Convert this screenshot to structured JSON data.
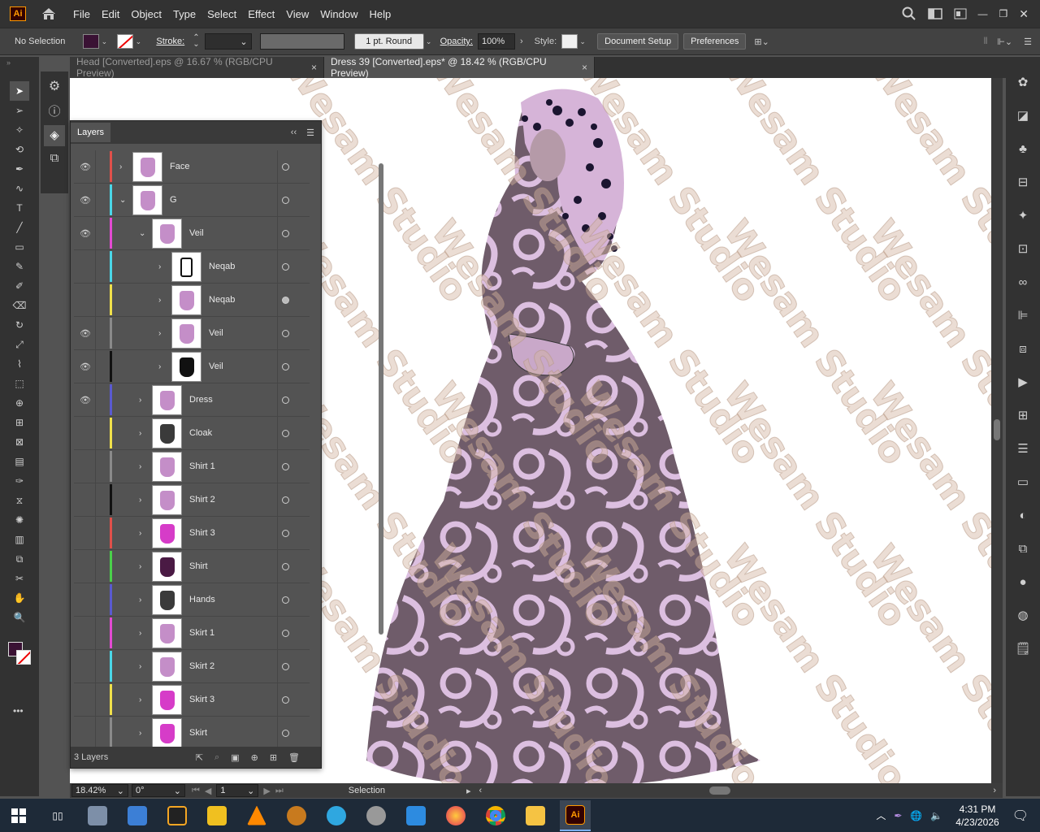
{
  "app": {
    "logo": "Ai"
  },
  "menu": [
    "File",
    "Edit",
    "Object",
    "Type",
    "Select",
    "Effect",
    "View",
    "Window",
    "Help"
  ],
  "control": {
    "selection": "No Selection",
    "stroke_label": "Stroke:",
    "brush": "1 pt. Round",
    "opacity_label": "Opacity:",
    "opacity": "100%",
    "style_label": "Style:",
    "doc_setup": "Document Setup",
    "preferences": "Preferences",
    "fill_color": "#3a1234",
    "stroke_color": "#ffffff"
  },
  "tabs": [
    {
      "label": "Head [Converted].eps @ 16.67 % (RGB/CPU Preview)",
      "close": "×"
    },
    {
      "label": "Dress 39 [Converted].eps* @ 18.42 % (RGB/CPU Preview)",
      "close": "×"
    }
  ],
  "layers_panel": {
    "title": "Layers",
    "footer": "3 Layers",
    "rows": [
      {
        "name": "Face",
        "color": "#e0504a",
        "visible": true,
        "indent": 0,
        "expanded": false,
        "thumb": "face-thumbnail",
        "target": "empty"
      },
      {
        "name": "G",
        "color": "#4ad7e8",
        "visible": true,
        "indent": 0,
        "expanded": true,
        "thumb": "figure-thumbnail",
        "target": "empty"
      },
      {
        "name": "Veil",
        "color": "#e34ad2",
        "visible": true,
        "indent": 1,
        "expanded": true,
        "thumb": "veil-pattern-thumbnail",
        "target": "empty"
      },
      {
        "name": "Neqab",
        "color": "#4ad7e8",
        "visible": false,
        "indent": 2,
        "expanded": false,
        "thumb": "neqab-outline-thumbnail",
        "target": "empty"
      },
      {
        "name": "Neqab",
        "color": "#f0e04a",
        "visible": false,
        "indent": 2,
        "expanded": false,
        "thumb": "neqab-fill-thumbnail",
        "target": "filled"
      },
      {
        "name": "Veil",
        "color": "#8a8a8a",
        "visible": true,
        "indent": 2,
        "expanded": false,
        "thumb": "veil-light-thumbnail",
        "target": "empty"
      },
      {
        "name": "Veil",
        "color": "#111111",
        "visible": true,
        "indent": 2,
        "expanded": false,
        "thumb": "veil-dark-thumbnail",
        "target": "empty"
      },
      {
        "name": "Dress",
        "color": "#5a5ad0",
        "visible": true,
        "indent": 1,
        "expanded": false,
        "thumb": "dress-thumbnail",
        "target": "empty"
      },
      {
        "name": "Cloak",
        "color": "#f0e04a",
        "visible": false,
        "indent": 1,
        "expanded": false,
        "thumb": "cloak-thumbnail",
        "target": "empty"
      },
      {
        "name": "Shirt 1",
        "color": "#8a8a8a",
        "visible": false,
        "indent": 1,
        "expanded": false,
        "thumb": "shirt1-thumbnail",
        "target": "empty"
      },
      {
        "name": "Shirt 2",
        "color": "#111111",
        "visible": false,
        "indent": 1,
        "expanded": false,
        "thumb": "shirt2-thumbnail",
        "target": "empty"
      },
      {
        "name": "Shirt 3",
        "color": "#e0504a",
        "visible": false,
        "indent": 1,
        "expanded": false,
        "thumb": "shirt3-thumbnail",
        "target": "empty"
      },
      {
        "name": "Shirt",
        "color": "#4ad04a",
        "visible": false,
        "indent": 1,
        "expanded": false,
        "thumb": "shirt-thumbnail",
        "target": "empty"
      },
      {
        "name": "Hands",
        "color": "#5a5ad0",
        "visible": false,
        "indent": 1,
        "expanded": false,
        "thumb": "hands-thumbnail",
        "target": "empty"
      },
      {
        "name": "Skirt 1",
        "color": "#e34ad2",
        "visible": false,
        "indent": 1,
        "expanded": false,
        "thumb": "skirt1-thumbnail",
        "target": "empty"
      },
      {
        "name": "Skirt 2",
        "color": "#4ad7e8",
        "visible": false,
        "indent": 1,
        "expanded": false,
        "thumb": "skirt2-thumbnail",
        "target": "empty"
      },
      {
        "name": "Skirt 3",
        "color": "#f0e04a",
        "visible": false,
        "indent": 1,
        "expanded": false,
        "thumb": "skirt3-thumbnail",
        "target": "empty"
      },
      {
        "name": "Skirt",
        "color": "#8a8a8a",
        "visible": false,
        "indent": 1,
        "expanded": false,
        "thumb": "skirt-thumbnail",
        "target": "empty"
      }
    ]
  },
  "status": {
    "zoom": "18.42%",
    "rotation": "0°",
    "artboard": "1",
    "tool": "Selection"
  },
  "watermark": "Wesam Studio",
  "taskbar": {
    "time": "4:31 PM",
    "date": "4/23/2026"
  }
}
